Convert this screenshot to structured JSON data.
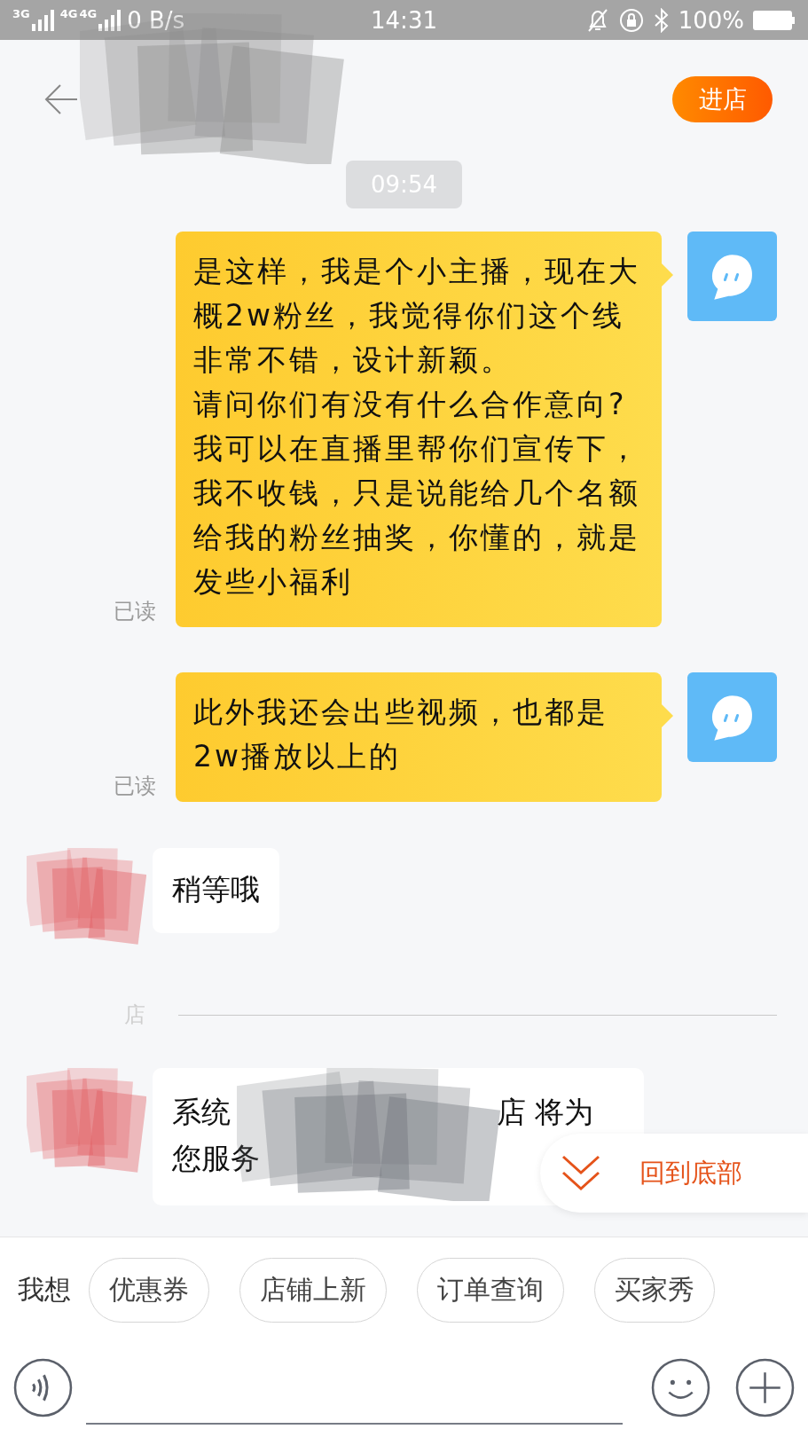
{
  "status_bar": {
    "network_1": "3G",
    "network_2": "4G",
    "network_3": "4G",
    "speed": "0 B/s",
    "time": "14:31",
    "battery": "100%"
  },
  "header": {
    "store_button": "进店"
  },
  "timestamp": "09:54",
  "messages": [
    {
      "kind": "outgoing",
      "paragraphs": [
        "是这样，我是个小主播，现在大概2w粉丝，我觉得你们这个线非常不错，设计新颖。",
        "请问你们有没有什么合作意向?",
        "我可以在直播里帮你们宣传下，我不收钱，只是说能给几个名额给我的粉丝抽奖，你懂的，就是发些小福利"
      ],
      "read_label": "已读"
    },
    {
      "kind": "outgoing",
      "paragraphs": [
        "此外我还会出些视频，也都是2w播放以上的"
      ],
      "read_label": "已读"
    },
    {
      "kind": "incoming",
      "text": "稍等哦"
    },
    {
      "kind": "divider",
      "label": "店"
    },
    {
      "kind": "system",
      "parts": [
        "系统",
        "店 将为",
        "您服务"
      ]
    }
  ],
  "back_to_bottom": "回到底部",
  "quick_bar": {
    "label": "我想",
    "chips": [
      "优惠券",
      "店铺上新",
      "订单查询",
      "买家秀"
    ]
  }
}
